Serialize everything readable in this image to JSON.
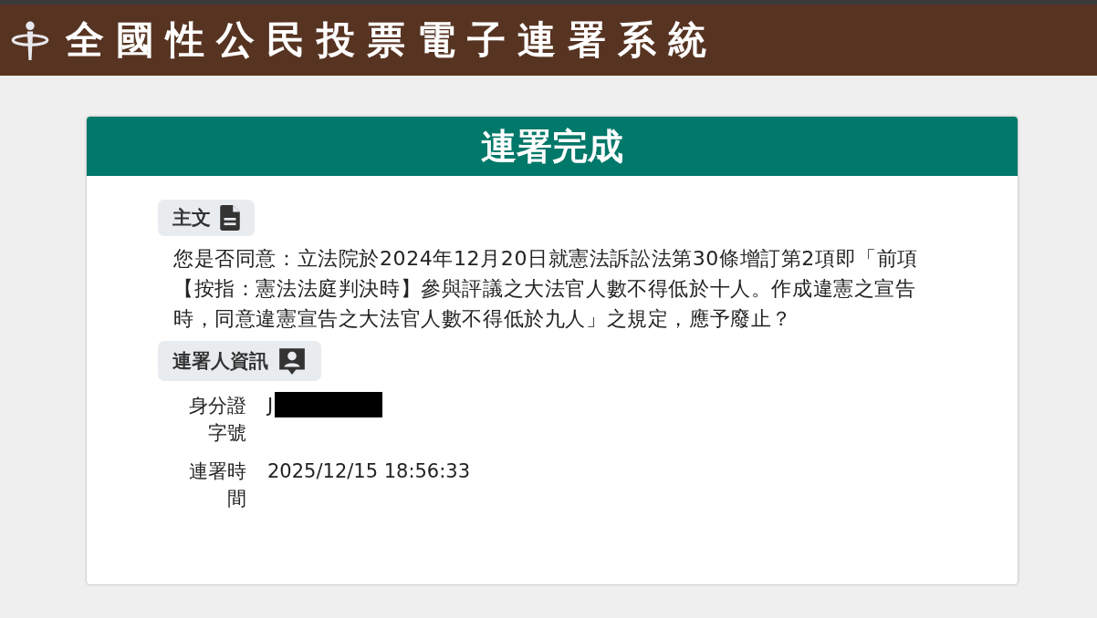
{
  "header": {
    "title": "全國性公民投票電子連署系統"
  },
  "card": {
    "title": "連署完成",
    "sections": [
      {
        "kind": "text",
        "heading": "主文",
        "text": "您是否同意：立法院於2024年12月20日就憲法訴訟法第30條增訂第2項即「前項【按指：憲法法庭判決時】參與評議之大法官人數不得低於十人。作成違憲之宣告時，同意違憲宣告之大法官人數不得低於九人」之規定，應予廢止？"
      },
      {
        "kind": "fields",
        "heading": "連署人資訊",
        "fields": [
          {
            "label": "身分證字號",
            "value": "J",
            "redacted": true
          },
          {
            "label": "連署時間",
            "value": "2025/12/15 18:56:33"
          }
        ]
      }
    ]
  }
}
